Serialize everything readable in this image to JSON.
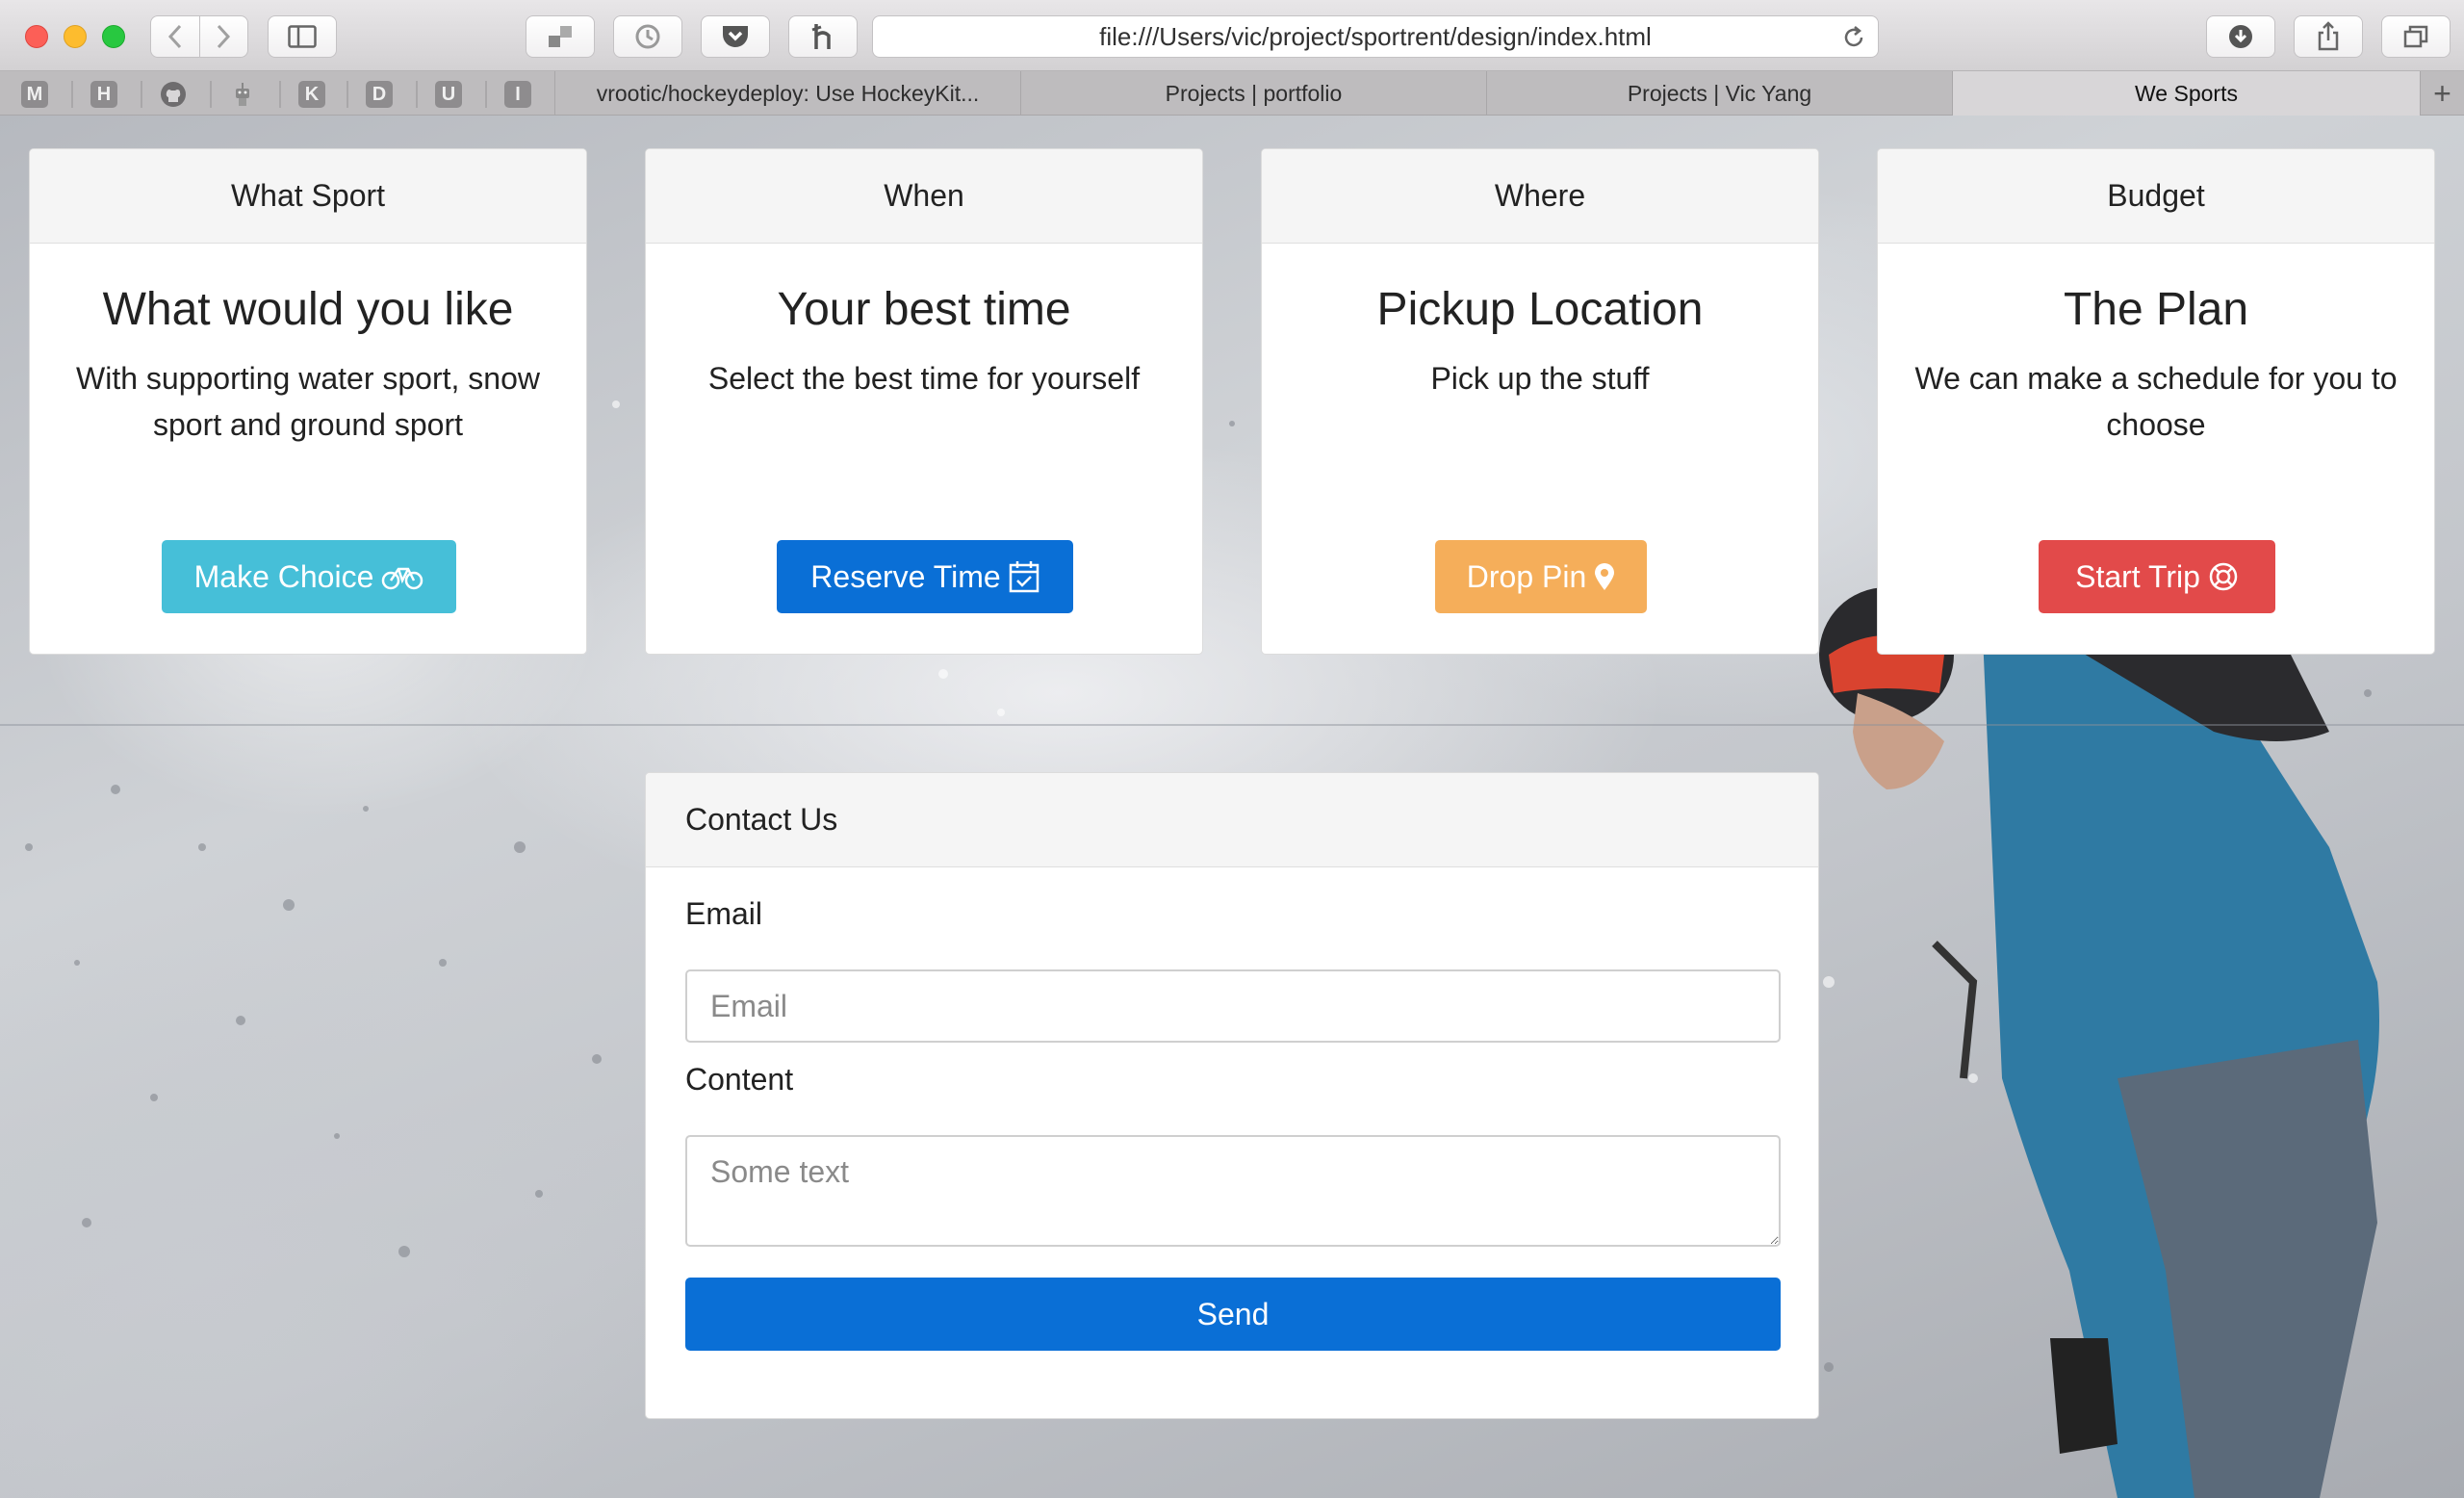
{
  "browser": {
    "url": "file:///Users/vic/project/sportrent/design/index.html",
    "bookmarks": [
      "M",
      "H",
      "",
      "",
      "K",
      "D",
      "U",
      "I"
    ],
    "tabs": [
      {
        "title": "vrootic/hockeydeploy: Use HockeyKit...",
        "active": false
      },
      {
        "title": "Projects | portfolio",
        "active": false
      },
      {
        "title": "Projects | Vic Yang",
        "active": false
      },
      {
        "title": "We Sports",
        "active": true
      }
    ],
    "new_tab_label": "+"
  },
  "cards": [
    {
      "header": "What Sport",
      "title": "What would you like",
      "text": "With supporting water sport, snow sport and ground sport",
      "button": "Make Choice",
      "icon": "bicycle-icon",
      "color": "#46bfd8"
    },
    {
      "header": "When",
      "title": "Your best time",
      "text": "Select the best time for yourself",
      "button": "Reserve Time",
      "icon": "calendar-check-icon",
      "color": "#0a6fd6"
    },
    {
      "header": "Where",
      "title": "Pickup Location",
      "text": "Pick up the stuff",
      "button": "Drop Pin",
      "icon": "map-marker-icon",
      "color": "#f5ae5a"
    },
    {
      "header": "Budget",
      "title": "The Plan",
      "text": "We can make a schedule for you to choose",
      "button": "Start Trip",
      "icon": "life-ring-icon",
      "color": "#e24a4a"
    }
  ],
  "contact": {
    "header": "Contact Us",
    "email_label": "Email",
    "email_placeholder": "Email",
    "content_label": "Content",
    "content_placeholder": "Some text",
    "send_label": "Send",
    "send_color": "#0a6fd6"
  }
}
